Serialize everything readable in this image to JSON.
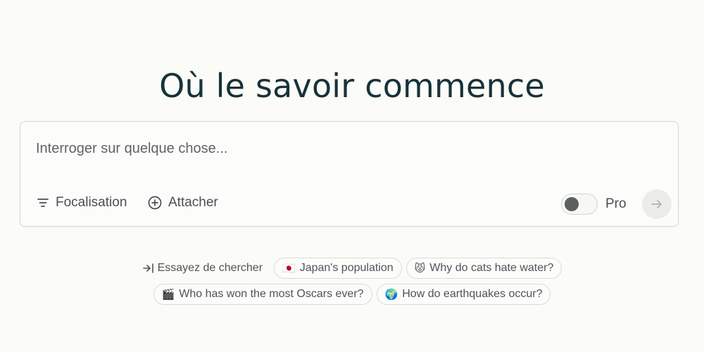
{
  "header": {
    "title": "Où le savoir commence"
  },
  "search": {
    "placeholder": "Interroger sur quelque chose...",
    "value": "",
    "focus_label": "Focalisation",
    "attach_label": "Attacher",
    "pro_label": "Pro",
    "pro_enabled": false
  },
  "suggestions": {
    "try_label": "Essayez de chercher",
    "chips": [
      {
        "emoji": "🇯🇵",
        "label": "Japan's population"
      },
      {
        "emoji": "😾",
        "label": "Why do cats hate water?"
      },
      {
        "emoji": "🎬",
        "label": "Who has won the most Oscars ever?"
      },
      {
        "emoji": "🌍",
        "label": "How do earthquakes occur?"
      }
    ]
  },
  "icons": {
    "focus": "filter-lines-icon",
    "attach": "plus-circle-icon",
    "submit": "arrow-right-icon",
    "try": "arrow-into-icon"
  },
  "colors": {
    "background": "#fbfbf7",
    "title": "#17323a",
    "text": "#4a4f52",
    "toggle_knob": "#5c5f5f",
    "submit_bg": "#ececea"
  }
}
